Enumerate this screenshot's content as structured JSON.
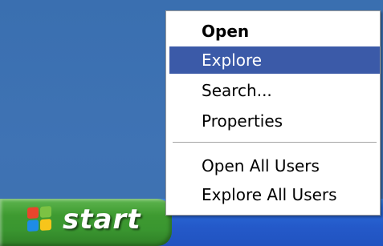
{
  "context_menu": {
    "items": [
      {
        "label": "Open",
        "bold": true
      },
      {
        "label": "Explore",
        "highlighted": true
      },
      {
        "label": "Search..."
      },
      {
        "label": "Properties"
      },
      {
        "label": "Open All Users"
      },
      {
        "label": "Explore All Users"
      }
    ],
    "highlight_color": "#3b5aa8"
  },
  "taskbar": {
    "start_label": "start",
    "start_icon": "windows-logo-icon",
    "start_color": "#3e9a31",
    "taskbar_color": "#2459c9"
  },
  "desktop": {
    "background_color": "#3a6fb0"
  }
}
